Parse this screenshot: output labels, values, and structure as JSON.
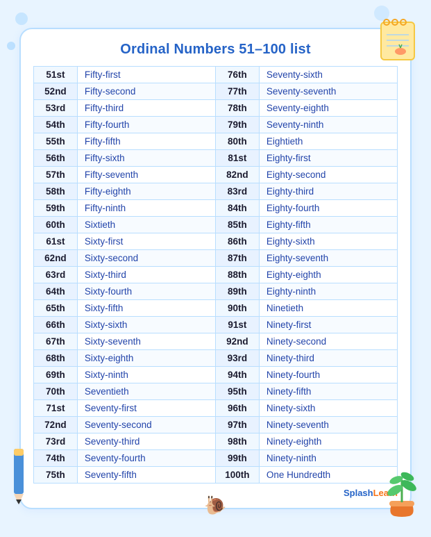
{
  "title": "Ordinal Numbers 51–100 list",
  "rows": [
    {
      "num1": "51st",
      "word1": "Fifty-first",
      "num2": "76th",
      "word2": "Seventy-sixth"
    },
    {
      "num1": "52nd",
      "word1": "Fifty-second",
      "num2": "77th",
      "word2": "Seventy-seventh"
    },
    {
      "num1": "53rd",
      "word1": "Fifty-third",
      "num2": "78th",
      "word2": "Seventy-eighth"
    },
    {
      "num1": "54th",
      "word1": "Fifty-fourth",
      "num2": "79th",
      "word2": "Seventy-ninth"
    },
    {
      "num1": "55th",
      "word1": "Fifty-fifth",
      "num2": "80th",
      "word2": "Eightieth"
    },
    {
      "num1": "56th",
      "word1": "Fifty-sixth",
      "num2": "81st",
      "word2": "Eighty-first"
    },
    {
      "num1": "57th",
      "word1": "Fifty-seventh",
      "num2": "82nd",
      "word2": "Eighty-second"
    },
    {
      "num1": "58th",
      "word1": "Fifty-eighth",
      "num2": "83rd",
      "word2": "Eighty-third"
    },
    {
      "num1": "59th",
      "word1": "Fifty-ninth",
      "num2": "84th",
      "word2": "Eighty-fourth"
    },
    {
      "num1": "60th",
      "word1": "Sixtieth",
      "num2": "85th",
      "word2": "Eighty-fifth"
    },
    {
      "num1": "61st",
      "word1": "Sixty-first",
      "num2": "86th",
      "word2": "Eighty-sixth"
    },
    {
      "num1": "62nd",
      "word1": "Sixty-second",
      "num2": "87th",
      "word2": "Eighty-seventh"
    },
    {
      "num1": "63rd",
      "word1": "Sixty-third",
      "num2": "88th",
      "word2": "Eighty-eighth"
    },
    {
      "num1": "64th",
      "word1": "Sixty-fourth",
      "num2": "89th",
      "word2": "Eighty-ninth"
    },
    {
      "num1": "65th",
      "word1": "Sixty-fifth",
      "num2": "90th",
      "word2": "Ninetieth"
    },
    {
      "num1": "66th",
      "word1": "Sixty-sixth",
      "num2": "91st",
      "word2": "Ninety-first"
    },
    {
      "num1": "67th",
      "word1": "Sixty-seventh",
      "num2": "92nd",
      "word2": "Ninety-second"
    },
    {
      "num1": "68th",
      "word1": "Sixty-eighth",
      "num2": "93rd",
      "word2": "Ninety-third"
    },
    {
      "num1": "69th",
      "word1": "Sixty-ninth",
      "num2": "94th",
      "word2": "Ninety-fourth"
    },
    {
      "num1": "70th",
      "word1": "Seventieth",
      "num2": "95th",
      "word2": "Ninety-fifth"
    },
    {
      "num1": "71st",
      "word1": "Seventy-first",
      "num2": "96th",
      "word2": "Ninety-sixth"
    },
    {
      "num1": "72nd",
      "word1": "Seventy-second",
      "num2": "97th",
      "word2": "Ninety-seventh"
    },
    {
      "num1": "73rd",
      "word1": "Seventy-third",
      "num2": "98th",
      "word2": "Ninety-eighth"
    },
    {
      "num1": "74th",
      "word1": "Seventy-fourth",
      "num2": "99th",
      "word2": "Ninety-ninth"
    },
    {
      "num1": "75th",
      "word1": "Seventy-fifth",
      "num2": "100th",
      "word2": "One Hundredth"
    }
  ],
  "footer": {
    "brand1": "Splash",
    "brand2": "Learn"
  }
}
